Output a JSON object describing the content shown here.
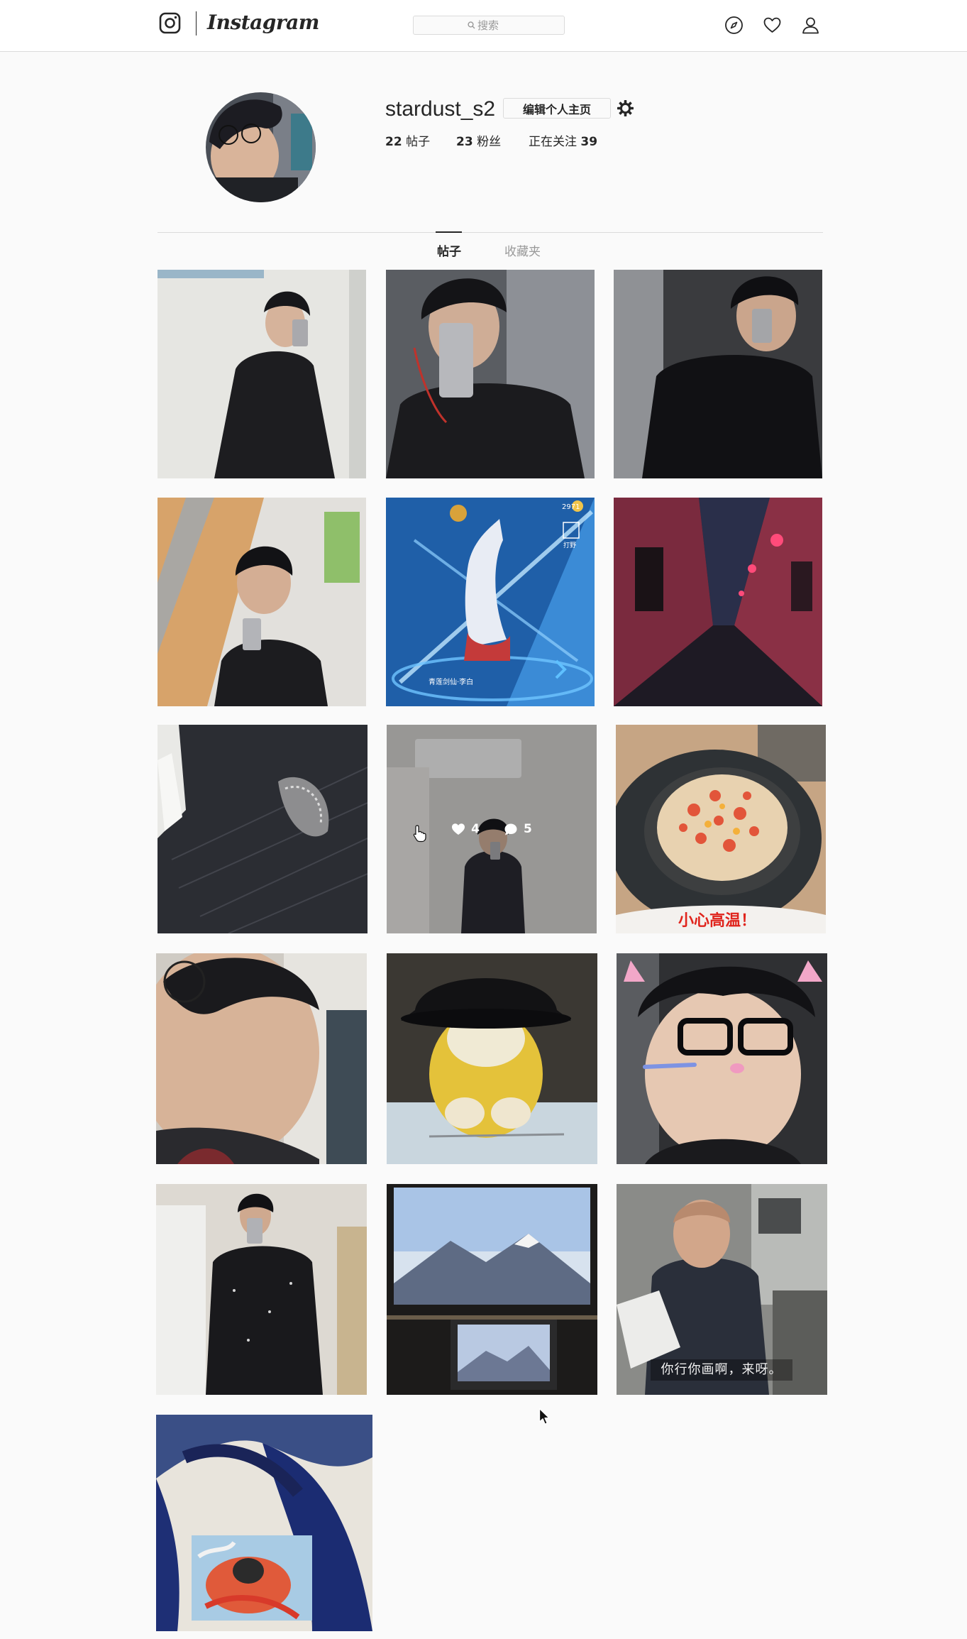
{
  "nav": {
    "brand": "Instagram",
    "search_placeholder": "搜索"
  },
  "profile": {
    "username": "stardust_s2",
    "edit_label": "编辑个人主页",
    "stats": {
      "posts_count": "22",
      "posts_label": "帖子",
      "followers_count": "23",
      "followers_label": "粉丝",
      "following_label": "正在关注",
      "following_count": "39"
    }
  },
  "tabs": [
    {
      "label": "帖子",
      "active": true
    },
    {
      "label": "收藏夹",
      "active": false
    }
  ],
  "posts": [
    {
      "subject": "mirror selfie, black shirt, white wall"
    },
    {
      "subject": "mirror selfie with earphones"
    },
    {
      "subject": "mirror selfie, dark background"
    },
    {
      "subject": "selfie in doorway with glasses"
    },
    {
      "subject": "game character screenshot",
      "game_text": [
        "2971",
        "打野",
        "青莲剑仙·李白"
      ]
    },
    {
      "subject": "alley at night with red lanterns"
    },
    {
      "subject": "dark knit fabric close-up"
    },
    {
      "subject": "mirror selfie in bathroom",
      "hover": {
        "likes": "4",
        "comments": "5"
      }
    },
    {
      "subject": "bowl of fried rice",
      "caption": "小心高温！"
    },
    {
      "subject": "close-up face with glasses"
    },
    {
      "subject": "yellow duck plush with black hat"
    },
    {
      "subject": "selfie with face filter"
    },
    {
      "subject": "mirror selfie in jacket"
    },
    {
      "subject": "desktop monitor and laptop with mountain wallpaper"
    },
    {
      "subject": "man holding laptop",
      "caption": "你行你画啊，来呀。"
    },
    {
      "subject": "printed fabric with blue cloth"
    }
  ],
  "colors": {
    "background": "#fafafa",
    "text": "#262626",
    "muted": "#999999",
    "border": "#dbdbdb"
  }
}
